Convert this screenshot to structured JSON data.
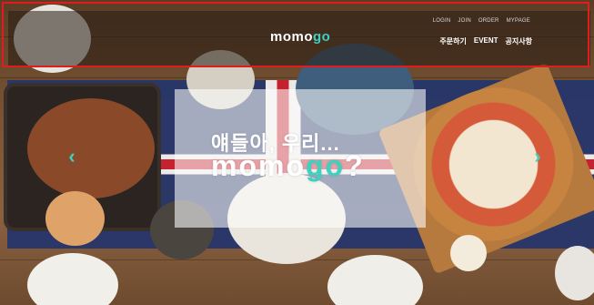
{
  "header": {
    "logo_main": "momo",
    "logo_accent": "go",
    "top_links": [
      "LOGIN",
      "JOIN",
      "ORDER",
      "MYPAGE"
    ],
    "main_links": [
      "주문하기",
      "EVENT",
      "공지사항"
    ]
  },
  "hero": {
    "line1": "얘들아, 우리...",
    "line2_main": "momo",
    "line2_accent": "go",
    "line2_suffix": "?"
  },
  "slider": {
    "prev_icon": "chevron-left-icon",
    "next_icon": "chevron-right-icon",
    "prev_glyph": "‹",
    "next_glyph": "›"
  },
  "colors": {
    "accent": "#3fd0c0",
    "highlight_border": "#e01d1d"
  }
}
